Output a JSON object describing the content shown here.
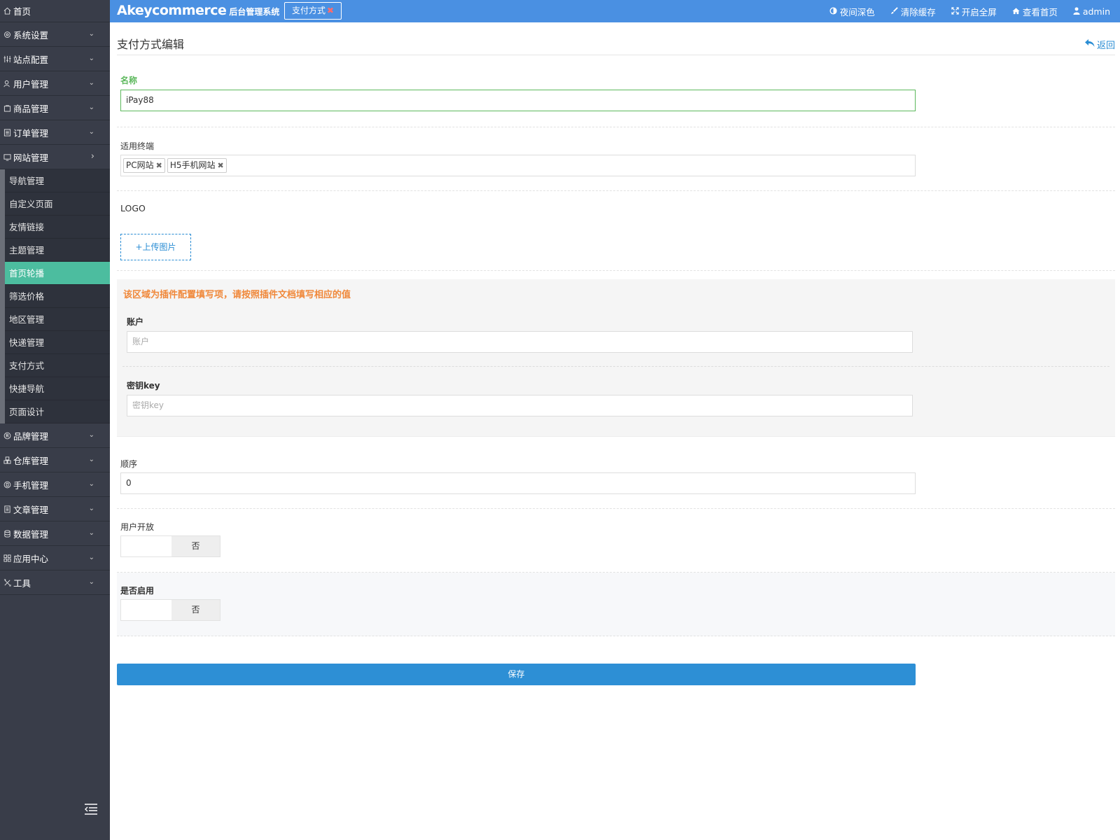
{
  "topbar": {
    "brand_name": "Akeycommerce",
    "brand_sub": "后台管理系统",
    "active_tab": "支付方式",
    "nav": {
      "night": "夜间深色",
      "clear_cache": "清除缓存",
      "fullscreen": "开启全屏",
      "view_home": "查看首页",
      "user": "admin"
    }
  },
  "sidebar": {
    "home": "首页",
    "items": [
      {
        "label": "系统设置"
      },
      {
        "label": "站点配置"
      },
      {
        "label": "用户管理"
      },
      {
        "label": "商品管理"
      },
      {
        "label": "订单管理"
      },
      {
        "label": "网站管理"
      }
    ],
    "website_sub": [
      {
        "label": "导航管理"
      },
      {
        "label": "自定义页面"
      },
      {
        "label": "友情链接"
      },
      {
        "label": "主题管理"
      },
      {
        "label": "首页轮播"
      },
      {
        "label": "筛选价格"
      },
      {
        "label": "地区管理"
      },
      {
        "label": "快递管理"
      },
      {
        "label": "支付方式"
      },
      {
        "label": "快捷导航"
      },
      {
        "label": "页面设计"
      }
    ],
    "items_after": [
      {
        "label": "品牌管理"
      },
      {
        "label": "仓库管理"
      },
      {
        "label": "手机管理"
      },
      {
        "label": "文章管理"
      },
      {
        "label": "数据管理"
      },
      {
        "label": "应用中心"
      },
      {
        "label": "工具"
      }
    ]
  },
  "page": {
    "title": "支付方式编辑",
    "back": "返回"
  },
  "form": {
    "name_label": "名称",
    "name_value": "iPay88",
    "terminal_label": "适用终端",
    "terminals": [
      "PC网站",
      "H5手机网站"
    ],
    "logo_label": "LOGO",
    "upload_label": "+上传图片",
    "plugin_notice": "该区域为插件配置填写项，请按照插件文档填写相应的值",
    "account_label": "账户",
    "account_placeholder": "账户",
    "key_label": "密钥key",
    "key_placeholder": "密钥key",
    "order_label": "顺序",
    "order_value": "0",
    "user_open_label": "用户开放",
    "user_open_value": "否",
    "enable_label": "是否启用",
    "enable_value": "否",
    "save_label": "保存"
  },
  "colors": {
    "topbar": "#4a90e2",
    "sidebar": "#393d49",
    "active_sub": "#4cbd9f",
    "primary": "#2d8fd5",
    "valid": "#5cb85c",
    "notice": "#f0883a"
  }
}
